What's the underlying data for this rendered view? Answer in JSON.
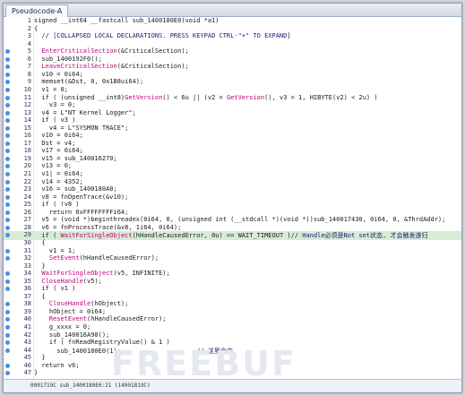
{
  "window": {
    "title": "Pseudocode-A"
  },
  "status_bar": {
    "text": "0001719C sub_1400180E0:21 (14001819C)"
  },
  "watermark": {
    "text": "FREEBUF"
  },
  "colors": {
    "default": "#1b1b1b",
    "comment": "#1a1a7a",
    "function": "#c0007a",
    "number": "#1b1b1b",
    "string": "#1b1b1b",
    "breakpoint_dot": "#4a90e2",
    "highlight_line": "#d7ecd4"
  },
  "lines": [
    {
      "no": "1",
      "dot": false,
      "hl": false,
      "segs": [
        {
          "t": "signed __int64 __fastcall sub_1400180E0(void *a1)",
          "c": "default"
        }
      ]
    },
    {
      "no": "2",
      "dot": false,
      "hl": false,
      "segs": [
        {
          "t": "{",
          "c": "default"
        }
      ]
    },
    {
      "no": "3",
      "dot": false,
      "hl": false,
      "segs": [
        {
          "t": "  // [COLLAPSED LOCAL DECLARATIONS. PRESS KEYPAD CTRL-\"+\" TO EXPAND]",
          "c": "comment"
        }
      ]
    },
    {
      "no": "4",
      "dot": false,
      "hl": false,
      "segs": [
        {
          "t": "",
          "c": "default"
        }
      ]
    },
    {
      "no": "5",
      "dot": true,
      "hl": false,
      "segs": [
        {
          "t": "  EnterCriticalSection",
          "c": "function"
        },
        {
          "t": "(&CriticalSection);",
          "c": "default"
        }
      ]
    },
    {
      "no": "6",
      "dot": true,
      "hl": false,
      "segs": [
        {
          "t": "  sub_1400192F0();",
          "c": "default"
        }
      ]
    },
    {
      "no": "7",
      "dot": true,
      "hl": false,
      "segs": [
        {
          "t": "  LeaveCriticalSection",
          "c": "function"
        },
        {
          "t": "(&CriticalSection);",
          "c": "default"
        }
      ]
    },
    {
      "no": "8",
      "dot": true,
      "hl": false,
      "segs": [
        {
          "t": "  v10 = 0i64;",
          "c": "default"
        }
      ]
    },
    {
      "no": "9",
      "dot": true,
      "hl": false,
      "segs": [
        {
          "t": "  memset(&Dst, 0, 0x1B8ui64);",
          "c": "default"
        }
      ]
    },
    {
      "no": "10",
      "dot": true,
      "hl": false,
      "segs": [
        {
          "t": "  v1 = 0;",
          "c": "default"
        }
      ]
    },
    {
      "no": "11",
      "dot": true,
      "hl": false,
      "segs": [
        {
          "t": "  if ( (unsigned __int8)",
          "c": "default"
        },
        {
          "t": "GetVersion",
          "c": "function"
        },
        {
          "t": "() < 6u || (v2 = ",
          "c": "default"
        },
        {
          "t": "GetVersion",
          "c": "function"
        },
        {
          "t": "(), v3 = 1, HIBYTE(v2) < 2u) )",
          "c": "default"
        }
      ]
    },
    {
      "no": "12",
      "dot": true,
      "hl": false,
      "segs": [
        {
          "t": "    v3 = 0;",
          "c": "default"
        }
      ]
    },
    {
      "no": "13",
      "dot": true,
      "hl": false,
      "segs": [
        {
          "t": "  v4 = L\"NT Kernel Logger\";",
          "c": "default"
        }
      ]
    },
    {
      "no": "14",
      "dot": true,
      "hl": false,
      "segs": [
        {
          "t": "  if ( v3 )",
          "c": "default"
        }
      ]
    },
    {
      "no": "15",
      "dot": true,
      "hl": false,
      "segs": [
        {
          "t": "    v4 = L\"SYSMON TRACE\";",
          "c": "default"
        }
      ]
    },
    {
      "no": "16",
      "dot": true,
      "hl": false,
      "segs": [
        {
          "t": "  v10 = 0i64;",
          "c": "default"
        }
      ]
    },
    {
      "no": "17",
      "dot": true,
      "hl": false,
      "segs": [
        {
          "t": "  Dst = v4;",
          "c": "default"
        }
      ]
    },
    {
      "no": "18",
      "dot": true,
      "hl": false,
      "segs": [
        {
          "t": "  v17 = 0i64;",
          "c": "default"
        }
      ]
    },
    {
      "no": "19",
      "dot": true,
      "hl": false,
      "segs": [
        {
          "t": "  v15 = sub_140016270;",
          "c": "default"
        }
      ]
    },
    {
      "no": "20",
      "dot": true,
      "hl": false,
      "segs": [
        {
          "t": "  v13 = 0;",
          "c": "default"
        }
      ]
    },
    {
      "no": "21",
      "dot": true,
      "hl": false,
      "segs": [
        {
          "t": "  v1| = 0i64;",
          "c": "default"
        }
      ]
    },
    {
      "no": "22",
      "dot": true,
      "hl": false,
      "segs": [
        {
          "t": "  v14 = 4352;",
          "c": "default"
        }
      ]
    },
    {
      "no": "23",
      "dot": true,
      "hl": false,
      "segs": [
        {
          "t": "  v16 = sub_1400180A0;",
          "c": "default"
        }
      ]
    },
    {
      "no": "24",
      "dot": true,
      "hl": false,
      "segs": [
        {
          "t": "  v8 = fnOpenTrace(&v10);",
          "c": "default"
        }
      ]
    },
    {
      "no": "25",
      "dot": true,
      "hl": false,
      "segs": [
        {
          "t": "  if ( !v8 )",
          "c": "default"
        }
      ]
    },
    {
      "no": "26",
      "dot": true,
      "hl": false,
      "segs": [
        {
          "t": "    return 0xFFFFFFFFi64;",
          "c": "default"
        }
      ]
    },
    {
      "no": "27",
      "dot": true,
      "hl": false,
      "segs": [
        {
          "t": "  v5 = (void *)beginthreadex(0i64, 0, (unsigned int (__stdcall *)(void *))sub_140017430, 0i64, 0, &ThrdAddr);",
          "c": "default"
        }
      ]
    },
    {
      "no": "28",
      "dot": true,
      "hl": false,
      "segs": [
        {
          "t": "  v6 = fnProcessTrace(&v8, 1i64, 0i64);",
          "c": "default"
        }
      ]
    },
    {
      "no": "29",
      "dot": true,
      "hl": true,
      "segs": [
        {
          "t": "  if ( ",
          "c": "default"
        },
        {
          "t": "WaitForSingleObject",
          "c": "function"
        },
        {
          "t": "(hHandleCausedError, 0u) == WAIT_TIMEOUT )",
          "c": "default"
        },
        {
          "t": "// Handle必须是Not set状态, 才会触发遂归",
          "c": "comment"
        }
      ]
    },
    {
      "no": "30",
      "dot": false,
      "hl": false,
      "segs": [
        {
          "t": "  {",
          "c": "default"
        }
      ]
    },
    {
      "no": "31",
      "dot": true,
      "hl": false,
      "segs": [
        {
          "t": "    v1 = 1;",
          "c": "default"
        }
      ]
    },
    {
      "no": "32",
      "dot": true,
      "hl": false,
      "segs": [
        {
          "t": "    SetEvent",
          "c": "function"
        },
        {
          "t": "(hHandleCausedError);",
          "c": "default"
        }
      ]
    },
    {
      "no": "33",
      "dot": false,
      "hl": false,
      "segs": [
        {
          "t": "  }",
          "c": "default"
        }
      ]
    },
    {
      "no": "34",
      "dot": true,
      "hl": false,
      "segs": [
        {
          "t": "  WaitForSingleObject",
          "c": "function"
        },
        {
          "t": "(v5, INFINITE);",
          "c": "default"
        }
      ]
    },
    {
      "no": "35",
      "dot": true,
      "hl": false,
      "segs": [
        {
          "t": "  CloseHandle",
          "c": "function"
        },
        {
          "t": "(v5);",
          "c": "default"
        }
      ]
    },
    {
      "no": "36",
      "dot": true,
      "hl": false,
      "segs": [
        {
          "t": "  if ( v1 )",
          "c": "default"
        }
      ]
    },
    {
      "no": "37",
      "dot": false,
      "hl": false,
      "segs": [
        {
          "t": "  {",
          "c": "default"
        }
      ]
    },
    {
      "no": "38",
      "dot": true,
      "hl": false,
      "segs": [
        {
          "t": "    CloseHandle",
          "c": "function"
        },
        {
          "t": "(hObject);",
          "c": "default"
        }
      ]
    },
    {
      "no": "39",
      "dot": true,
      "hl": false,
      "segs": [
        {
          "t": "    hObject = 0i64;",
          "c": "default"
        }
      ]
    },
    {
      "no": "40",
      "dot": true,
      "hl": false,
      "segs": [
        {
          "t": "    ResetEvent",
          "c": "function"
        },
        {
          "t": "(hHandleCausedError);",
          "c": "default"
        }
      ]
    },
    {
      "no": "41",
      "dot": true,
      "hl": false,
      "segs": [
        {
          "t": "    g_xxxx = 0;",
          "c": "default"
        }
      ]
    },
    {
      "no": "42",
      "dot": true,
      "hl": false,
      "segs": [
        {
          "t": "    sub_140016A90();",
          "c": "default"
        }
      ]
    },
    {
      "no": "43",
      "dot": true,
      "hl": false,
      "segs": [
        {
          "t": "    if ( fnReadRegistryValue() & 1 )",
          "c": "default"
        }
      ]
    },
    {
      "no": "44",
      "dot": true,
      "hl": false,
      "segs": [
        {
          "t": "      sub_1400180E0(1);                    ",
          "c": "default"
        },
        {
          "t": "// 这里命中",
          "c": "comment"
        }
      ]
    },
    {
      "no": "45",
      "dot": false,
      "hl": false,
      "segs": [
        {
          "t": "  }",
          "c": "default"
        }
      ]
    },
    {
      "no": "46",
      "dot": true,
      "hl": false,
      "segs": [
        {
          "t": "  return v6;",
          "c": "default"
        }
      ]
    },
    {
      "no": "47",
      "dot": true,
      "hl": false,
      "segs": [
        {
          "t": "}",
          "c": "default"
        }
      ]
    }
  ]
}
